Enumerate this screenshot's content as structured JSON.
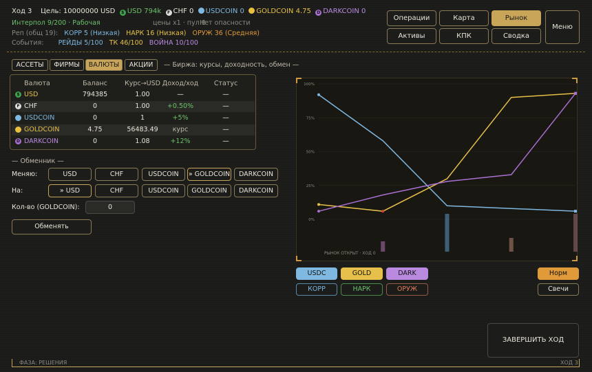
{
  "header": {
    "turn": "Ход 3",
    "goal": "Цель: 10000000 USD",
    "usd": "USD 794k",
    "chf": "CHF 0",
    "usdcoin": "USDCOIN 0",
    "goldcoin": "GOLDCOIN 4.75",
    "darkcoin": "DARKCOIN 0",
    "interpol": "Интерпол 9/200 · Рабочая",
    "prices": "цены x1 · пул 8",
    "danger": "Нет опасности",
    "rep_label": "Реп (общ 19):",
    "rep_korp": "КОРР 5 (Низкая)",
    "rep_nark": "НАРК 16 (Низкая)",
    "rep_oruzh": "ОРУЖ 36 (Средняя)",
    "events_label": "События:",
    "ev_raids": "РЕЙДЫ 5/100",
    "ev_tk": "ТК 46/100",
    "ev_war": "ВОЙНА 10/100"
  },
  "nav": {
    "operations": "Операции",
    "map": "Карта",
    "market": "Рынок",
    "assets": "Активы",
    "kpk": "КПК",
    "summary": "Сводка",
    "menu": "Меню"
  },
  "tabs": {
    "assets": "АССЕТЫ",
    "firms": "ФИРМЫ",
    "currencies": "ВАЛЮТЫ",
    "stocks": "АКЦИИ",
    "subtitle": "— Биржа: курсы, доходность, обмен —"
  },
  "table": {
    "headers": [
      "Валюта",
      "Баланс",
      "Курс→USD",
      "Доход/ход",
      "Статус"
    ],
    "rows": [
      {
        "icon": "$",
        "name": "USD",
        "balance": "794385",
        "rate": "1.00",
        "income": "—",
        "status": "—"
      },
      {
        "icon": "F",
        "name": "CHF",
        "balance": "0",
        "rate": "1.00",
        "income": "+0.50%",
        "status": "—"
      },
      {
        "icon": "U",
        "name": "USDCOIN",
        "balance": "0",
        "rate": "1",
        "income": "+5%",
        "status": "—"
      },
      {
        "icon": "G",
        "name": "GOLDCOIN",
        "balance": "4.75",
        "rate": "56483.49",
        "income": "курс",
        "status": "—"
      },
      {
        "icon": "D",
        "name": "DARKCOIN",
        "balance": "0",
        "rate": "1.08",
        "income": "+12%",
        "status": "—"
      }
    ]
  },
  "exchange": {
    "title": "— Обменник —",
    "from_label": "Меняю:",
    "to_label": "На:",
    "qty_label": "Кол-во (GOLDCOIN):",
    "qty_value": "0",
    "from": [
      "USD",
      "CHF",
      "USDCOIN",
      "» GOLDCOIN",
      "DARKCOIN"
    ],
    "to": [
      "» USD",
      "CHF",
      "USDCOIN",
      "GOLDCOIN",
      "DARKCOIN"
    ],
    "exchange_btn": "Обменять"
  },
  "chart_data": {
    "type": "line",
    "x": [
      1,
      2,
      3,
      4,
      5
    ],
    "yticks": [
      "100%",
      "75%",
      "50%",
      "25%",
      "0%"
    ],
    "ylim": [
      0,
      100
    ],
    "footer": "РЫНОК ОТКРЫТ · ХОД 0",
    "series": [
      {
        "name": "USDC",
        "color": "#7fb8e0",
        "values": [
          92,
          58,
          10,
          8,
          6
        ]
      },
      {
        "name": "GOLD",
        "color": "#e6c04a",
        "values": [
          11,
          6,
          30,
          90,
          93
        ]
      },
      {
        "name": "DARK",
        "color": "#a870d0",
        "values": [
          6,
          18,
          28,
          33,
          93
        ]
      }
    ],
    "volumes": [
      {
        "x": 2,
        "v": 6,
        "color": "#8a5a8a"
      },
      {
        "x": 3,
        "v": 22,
        "color": "#4a7a9a"
      },
      {
        "x": 4,
        "v": 8,
        "color": "#8a6a5a"
      },
      {
        "x": 5,
        "v": 22,
        "color": "#7a5a5a"
      }
    ]
  },
  "chart_buttons": {
    "usdc": "USDC",
    "gold": "GOLD",
    "dark": "DARK",
    "korp": "КОРР",
    "nark": "НАРК",
    "oruzh": "ОРУЖ",
    "norm": "Норм",
    "candles": "Свечи"
  },
  "end_turn": "ЗАВЕРШИТЬ ХОД",
  "footer": {
    "phase": "ФАЗА: РЕШЕНИЯ",
    "turn": "ХОД 3"
  }
}
